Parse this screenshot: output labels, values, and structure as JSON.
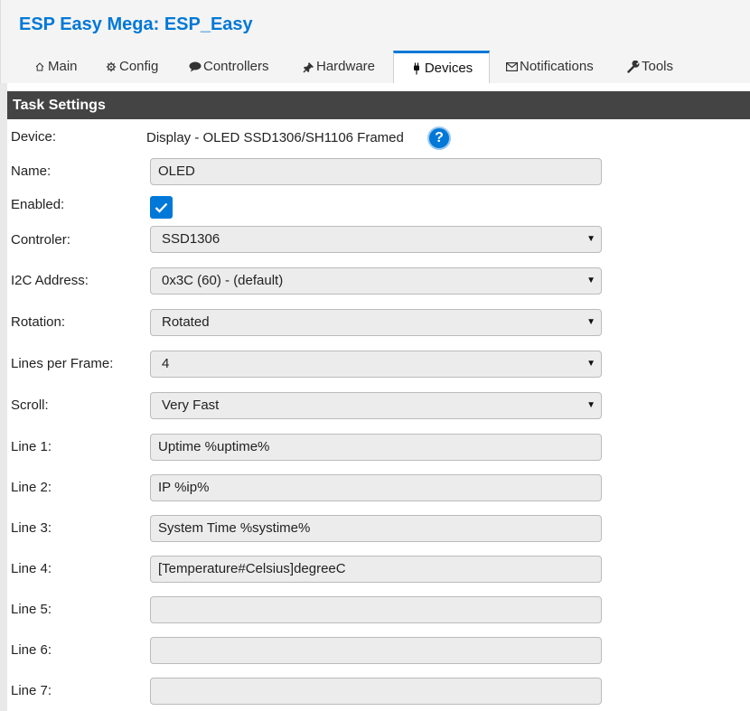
{
  "app": {
    "title": "ESP Easy Mega: ESP_Easy"
  },
  "tabs": [
    {
      "label": "Main",
      "icon": "home-icon"
    },
    {
      "label": "Config",
      "icon": "gear-icon"
    },
    {
      "label": "Controllers",
      "icon": "chat-bubble-icon"
    },
    {
      "label": "Hardware",
      "icon": "pin-icon"
    },
    {
      "label": "Devices",
      "icon": "plug-icon",
      "active": true
    },
    {
      "label": "Notifications",
      "icon": "envelope-icon"
    },
    {
      "label": "Tools",
      "icon": "wrench-icon"
    }
  ],
  "section": {
    "title": "Task Settings"
  },
  "form": {
    "device_label": "Device:",
    "device_value": "Display - OLED SSD1306/SH1106 Framed",
    "help_icon": "?",
    "name_label": "Name:",
    "name_value": "OLED",
    "enabled_label": "Enabled:",
    "enabled": true,
    "controler_label": "Controler:",
    "controler_value": "SSD1306",
    "i2c_label": "I2C Address:",
    "i2c_value": "0x3C (60) - (default)",
    "rotation_label": "Rotation:",
    "rotation_value": "Rotated",
    "lines_label": "Lines per Frame:",
    "lines_value": "4",
    "scroll_label": "Scroll:",
    "scroll_value": "Very Fast",
    "line1_label": "Line 1:",
    "line1_value": "Uptime %uptime%",
    "line2_label": "Line 2:",
    "line2_value": "IP %ip%",
    "line3_label": "Line 3:",
    "line3_value": "System Time %systime%",
    "line4_label": "Line 4:",
    "line4_value": "[Temperature#Celsius]degreeC",
    "line5_label": "Line 5:",
    "line5_value": "",
    "line6_label": "Line 6:",
    "line6_value": "",
    "line7_label": "Line 7:",
    "line7_value": ""
  },
  "colors": {
    "accent": "#0078d7",
    "section_bar": "#444444",
    "field_bg": "#ececec"
  }
}
